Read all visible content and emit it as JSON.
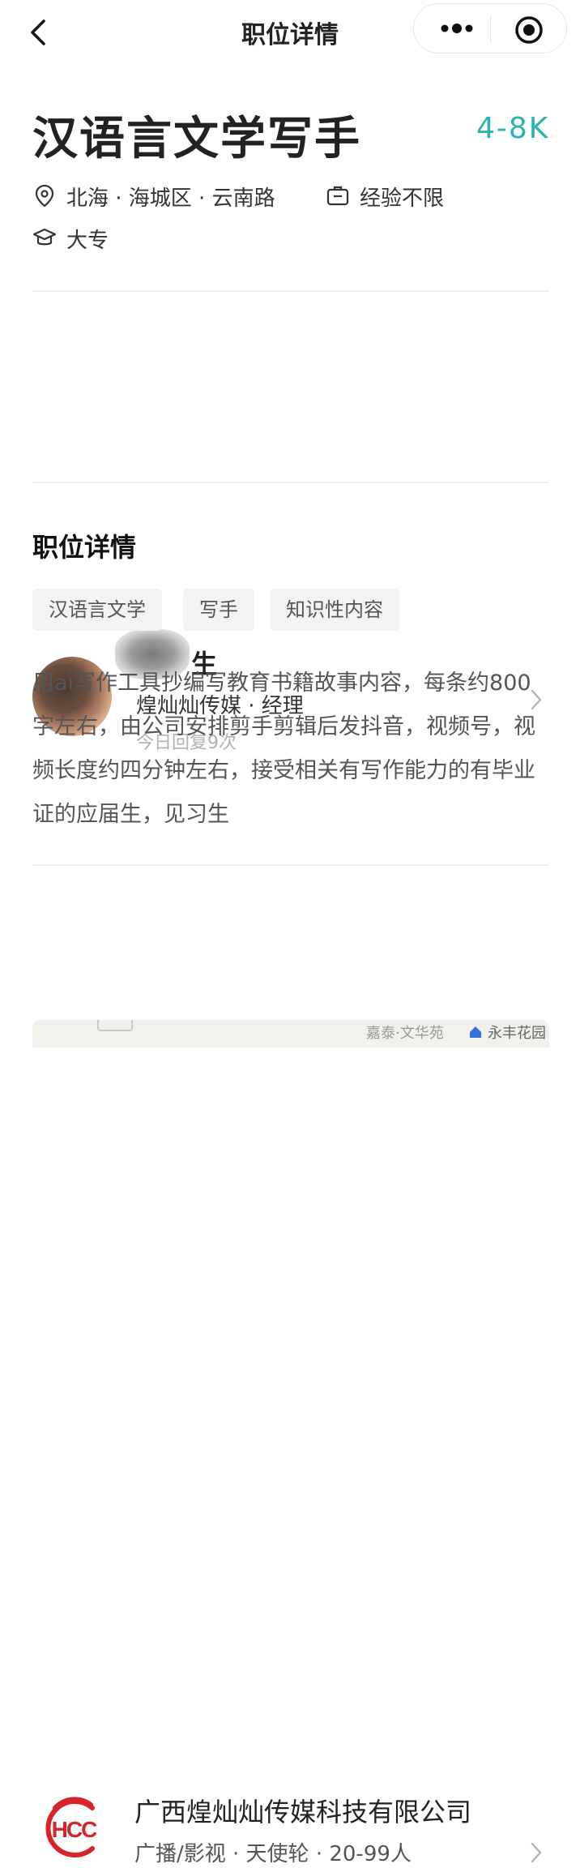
{
  "nav": {
    "title": "职位详情"
  },
  "job": {
    "title": "汉语言文学写手",
    "salary": "4-8K",
    "location": "北海 · 海城区 · 云南路",
    "experience": "经验不限",
    "education": "大专"
  },
  "recruiter": {
    "name_visible": "生",
    "company_role": "煌灿灿传媒 · 经理",
    "reply_info": "今日回复9次"
  },
  "details": {
    "section_title": "职位详情",
    "tags": [
      "汉语言文学",
      "写手",
      "知识性内容"
    ],
    "description": "用ai写作工具抄编写教育书籍故事内容，每条约800字左右，由公司安排剪手剪辑后发抖音，视频号，视频长度约四分钟左右，接受相关有写作能力的有毕业证的应届生，见习生"
  },
  "company": {
    "logo_text": "HCC",
    "name": "广西煌灿灿传媒科技有限公司",
    "meta": "广播/影视 · 天使轮 · 20-99人"
  },
  "map": {
    "labels": [
      "嘉泰·文华苑",
      "永丰花园"
    ]
  },
  "colors": {
    "salary": "#2ab4b0",
    "logo": "#d8232a"
  }
}
